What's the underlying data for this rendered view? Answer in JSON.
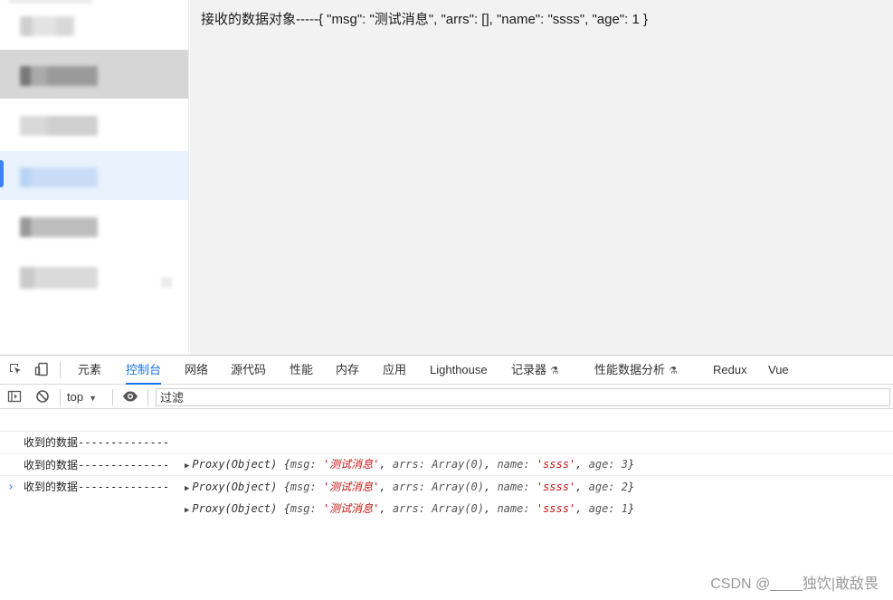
{
  "page": {
    "received_text": "接收的数据对象-----{ \"msg\": \"测试消息\", \"arrs\": [], \"name\": \"ssss\", \"age\": 1 }"
  },
  "devtools": {
    "tabs": [
      {
        "label": "元素"
      },
      {
        "label": "控制台",
        "active": true
      },
      {
        "label": "网络"
      },
      {
        "label": "源代码"
      },
      {
        "label": "性能"
      },
      {
        "label": "内存"
      },
      {
        "label": "应用"
      },
      {
        "label": "Lighthouse"
      },
      {
        "label": "记录器"
      },
      {
        "label": "性能数据分析"
      },
      {
        "label": "Redux"
      },
      {
        "label": "Vue"
      }
    ],
    "context": "top",
    "filter_placeholder": "过滤",
    "logs": [
      {
        "message": "收到的数据--------------",
        "proxy": "Proxy(Object)",
        "msg_key": "msg:",
        "msg_val": "'测试消息'",
        "arrs": "arrs: Array(0)",
        "name_key": "name:",
        "name_val": "'ssss'",
        "age": "age: 3"
      },
      {
        "message": "收到的数据--------------",
        "proxy": "Proxy(Object)",
        "msg_key": "msg:",
        "msg_val": "'测试消息'",
        "arrs": "arrs: Array(0)",
        "name_key": "name:",
        "name_val": "'ssss'",
        "age": "age: 2"
      },
      {
        "message": "收到的数据--------------",
        "proxy": "Proxy(Object)",
        "msg_key": "msg:",
        "msg_val": "'测试消息'",
        "arrs": "arrs: Array(0)",
        "name_key": "name:",
        "name_val": "'ssss'",
        "age": "age: 1"
      }
    ],
    "prompt": "›"
  },
  "watermark": "CSDN @____独饮|敢敌畏",
  "icons": {
    "inspect": "inspect-element-icon",
    "device": "device-toolbar-icon",
    "sidebar": "console-sidebar-icon",
    "clear": "clear-console-icon",
    "eye": "live-expression-icon",
    "flask": "experimental-flask-icon"
  },
  "colors": {
    "accent": "#1a73e8",
    "string": "#c41a16",
    "content_bg": "#f2f2f2",
    "active_item_bg": "#e9f2fd"
  }
}
